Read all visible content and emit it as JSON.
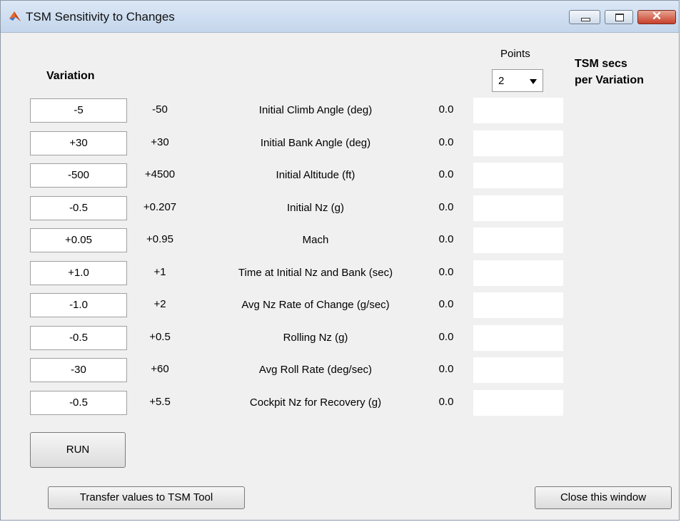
{
  "window": {
    "title": "TSM Sensitivity to Changes",
    "close_glyph": "✕"
  },
  "headers": {
    "variation": "Variation",
    "points": "Points",
    "tsm_line1": "TSM secs",
    "tsm_line2": "per Variation"
  },
  "points_select": {
    "value": "2"
  },
  "rows": [
    {
      "variation": "-5",
      "value": "-50",
      "label": "Initial Climb Angle (deg)",
      "result": "0.0",
      "output": ""
    },
    {
      "variation": "+30",
      "value": "+30",
      "label": "Initial Bank Angle (deg)",
      "result": "0.0",
      "output": ""
    },
    {
      "variation": "-500",
      "value": "+4500",
      "label": "Initial Altitude (ft)",
      "result": "0.0",
      "output": ""
    },
    {
      "variation": "-0.5",
      "value": "+0.207",
      "label": "Initial Nz (g)",
      "result": "0.0",
      "output": ""
    },
    {
      "variation": "+0.05",
      "value": "+0.95",
      "label": "Mach",
      "result": "0.0",
      "output": ""
    },
    {
      "variation": "+1.0",
      "value": "+1",
      "label": "Time at Initial Nz and Bank (sec)",
      "result": "0.0",
      "output": ""
    },
    {
      "variation": "-1.0",
      "value": "+2",
      "label": "Avg Nz Rate of Change (g/sec)",
      "result": "0.0",
      "output": ""
    },
    {
      "variation": "-0.5",
      "value": "+0.5",
      "label": "Rolling Nz (g)",
      "result": "0.0",
      "output": ""
    },
    {
      "variation": "-30",
      "value": "+60",
      "label": "Avg Roll Rate (deg/sec)",
      "result": "0.0",
      "output": ""
    },
    {
      "variation": "-0.5",
      "value": "+5.5",
      "label": "Cockpit Nz for Recovery (g)",
      "result": "0.0",
      "output": ""
    }
  ],
  "buttons": {
    "run": "RUN",
    "transfer": "Transfer values to TSM Tool",
    "close": "Close this window"
  },
  "icons": {
    "app": "matlab-icon",
    "minimize": "minimize-icon",
    "maximize": "maximize-icon",
    "close": "close-icon",
    "dropdown": "chevron-down-icon"
  }
}
